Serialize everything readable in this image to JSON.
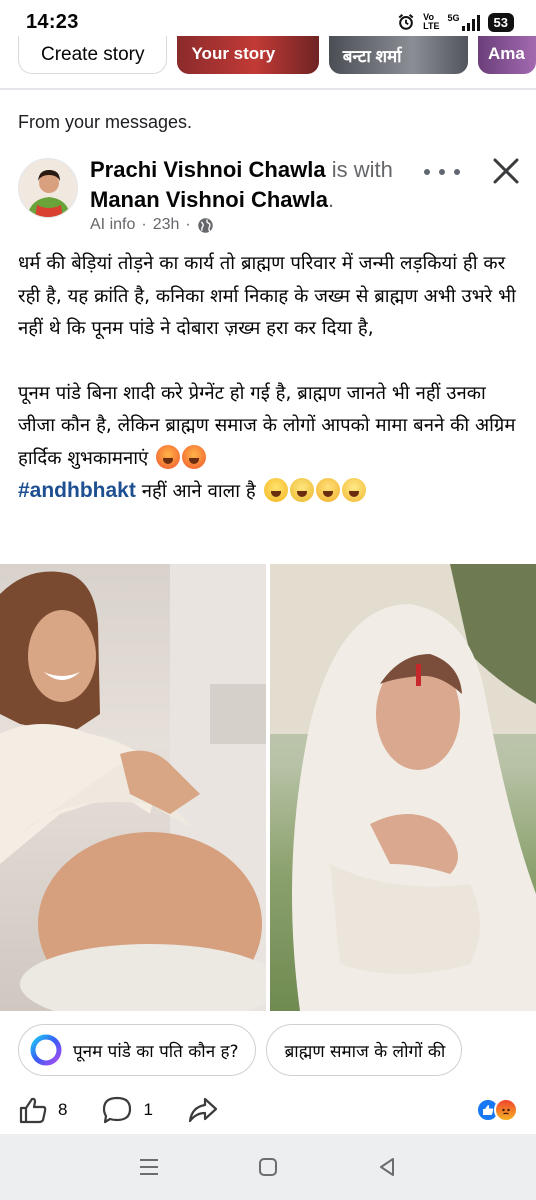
{
  "status_bar": {
    "time": "14:23",
    "volte_top": "Vo",
    "volte_bottom": "LTE",
    "network": "5G",
    "battery": "53",
    "icons": [
      "alarm-icon",
      "volte-icon",
      "signal-icon",
      "battery-icon"
    ]
  },
  "stories": {
    "create_label": "Create story",
    "items": [
      {
        "label": "Your story"
      },
      {
        "label": "बन्टा शर्मा"
      },
      {
        "label": "Ama"
      }
    ]
  },
  "feed": {
    "section_label": "From your messages."
  },
  "post": {
    "author": "Prachi Vishnoi Chawla",
    "with_text": "is with",
    "tagged": "Manan Vishnoi Chawla",
    "tagged_suffix": ".",
    "source": "AI info",
    "time": "23h",
    "separator": "·",
    "audience_icon": "globe-icon",
    "paragraph1": "धर्म की बेड़ियां तोड़ने का कार्य तो ब्राह्मण परिवार में जन्मी लड़कियां ही कर रही है, यह क्रांति है, कनिका शर्मा निकाह के जख्म से ब्राह्मण अभी उभरे भी नहीं थे कि पूनम पांडे ने दोबारा ज़ख्म हरा कर दिया है,",
    "paragraph2": "पूनम पांडे बिना शादी करे प्रेग्नेंट हो गई है, ब्राह्मण जानते भी नहीं उनका जीजा कौन है, लेकिन ब्राह्मण समाज के लोगों आपको मामा बनने की अग्रिम हार्दिक शुभकामनाएं",
    "hashtag": "#andhbhakt",
    "paragraph3": "नहीं आने वाला है",
    "images": [
      {
        "alt": "woman-smiling-showing-pregnant-belly"
      },
      {
        "alt": "woman-in-white-shawl-eyes-closed"
      }
    ]
  },
  "suggestions": [
    {
      "label": "पूनम पांडे का पति कौन ह?",
      "icon": "meta-ai-icon"
    },
    {
      "label": "ब्राह्मण समाज के लोगों की"
    }
  ],
  "actions": {
    "like_count": "8",
    "comment_count": "1",
    "reactions": [
      "like-icon",
      "angry-icon"
    ]
  },
  "navbar": {
    "buttons": [
      "recents-icon",
      "home-icon",
      "back-icon"
    ]
  },
  "colors": {
    "hashtag": "#1d4f91",
    "secondary_text": "#65676b",
    "like_blue": "#1877f2"
  }
}
